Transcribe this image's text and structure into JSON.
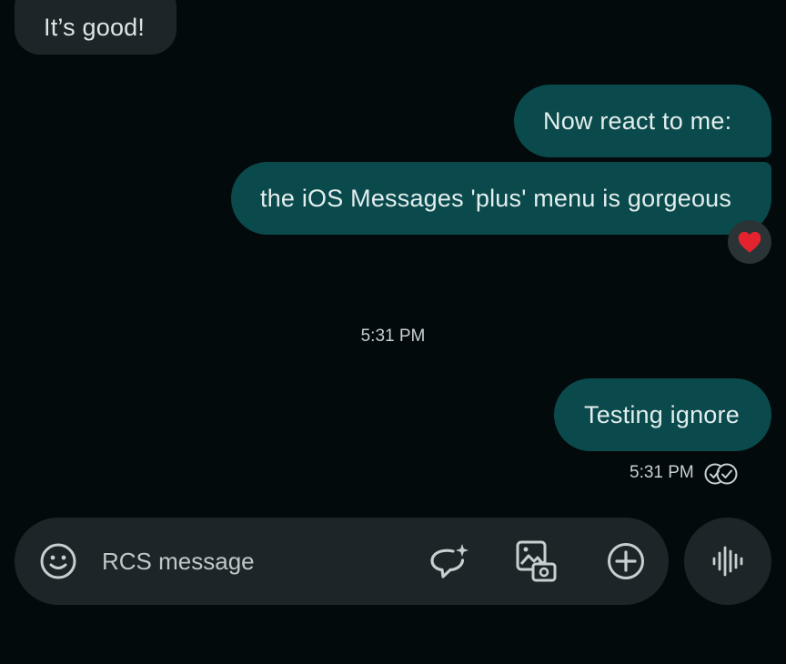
{
  "conversation": {
    "messages": [
      {
        "direction": "incoming",
        "text": "It’s good!"
      },
      {
        "direction": "outgoing",
        "text": "Now react to me:"
      },
      {
        "direction": "outgoing",
        "text": "the iOS Messages 'plus' menu is gorgeous",
        "reaction": "heart"
      },
      {
        "direction": "outgoing",
        "text": "Testing ignore"
      }
    ],
    "center_timestamp": "5:31 PM",
    "sent_timestamp": "5:31 PM",
    "read_receipt_icon": "double-check-circle-icon"
  },
  "composer": {
    "placeholder": "RCS message",
    "icons": [
      "emoji-icon",
      "ai-compose-icon",
      "gallery-icon",
      "add-icon",
      "voice-icon"
    ]
  },
  "colors": {
    "background": "#030a0c",
    "incoming_bubble": "#1c2628",
    "outgoing_bubble": "#0b4a4c",
    "reaction_heart": "#e5232e"
  }
}
